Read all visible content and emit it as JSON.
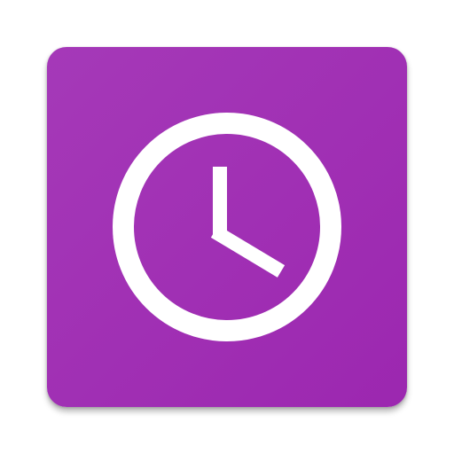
{
  "app_icon": {
    "icon": "clock-icon",
    "background_color": "#9C27B0",
    "background_highlight_color": "#A539B8",
    "foreground_color": "#FFFFFF",
    "clock_time": "4:00"
  }
}
